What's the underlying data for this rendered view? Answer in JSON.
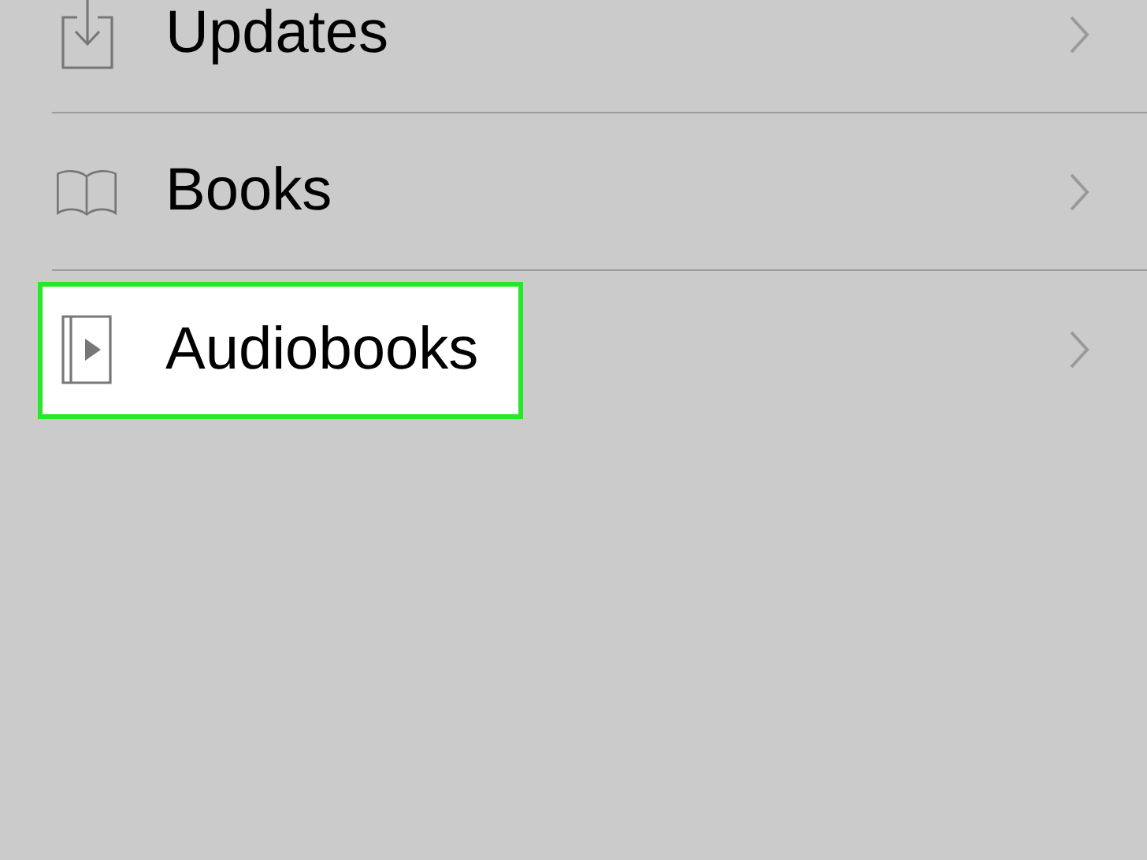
{
  "items": [
    {
      "label": "Updates",
      "highlighted": false
    },
    {
      "label": "Books",
      "highlighted": false
    },
    {
      "label": "Audiobooks",
      "highlighted": true
    }
  ]
}
